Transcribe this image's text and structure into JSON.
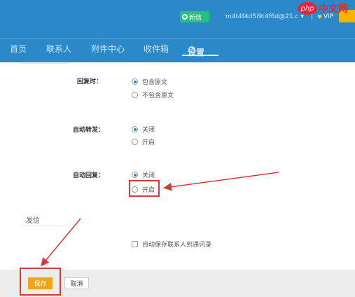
{
  "header": {
    "compose_label": "新信",
    "account_text": "m4t4f4d5i9t4f6d@21.c",
    "separator": "|",
    "vip_label": "VIP"
  },
  "watermark": {
    "logo_text": "php",
    "site_text": "中文网"
  },
  "nav": {
    "items": [
      "首页",
      "联系人",
      "附件中心",
      "收件箱",
      "设置"
    ]
  },
  "settings": {
    "reply": {
      "label": "回复时：",
      "options": [
        "包含原文",
        "不包含原文"
      ],
      "selected_index": 0
    },
    "auto_forward": {
      "label": "自动转发：",
      "options": [
        "关闭",
        "开启"
      ],
      "selected_index": 0
    },
    "auto_reply": {
      "label": "自动回复：",
      "options": [
        "关闭",
        "开启"
      ],
      "selected_index": 0
    },
    "send_section_title": "发信",
    "auto_save_contacts_label": "自动保存联系人到通讯录"
  },
  "footer": {
    "save_label": "保存",
    "cancel_label": "取消"
  },
  "colors": {
    "header_bg": "#2b89c9",
    "compose_green": "#27c17f",
    "save_orange": "#f5a31a",
    "annotation_red": "#d63a3a"
  }
}
